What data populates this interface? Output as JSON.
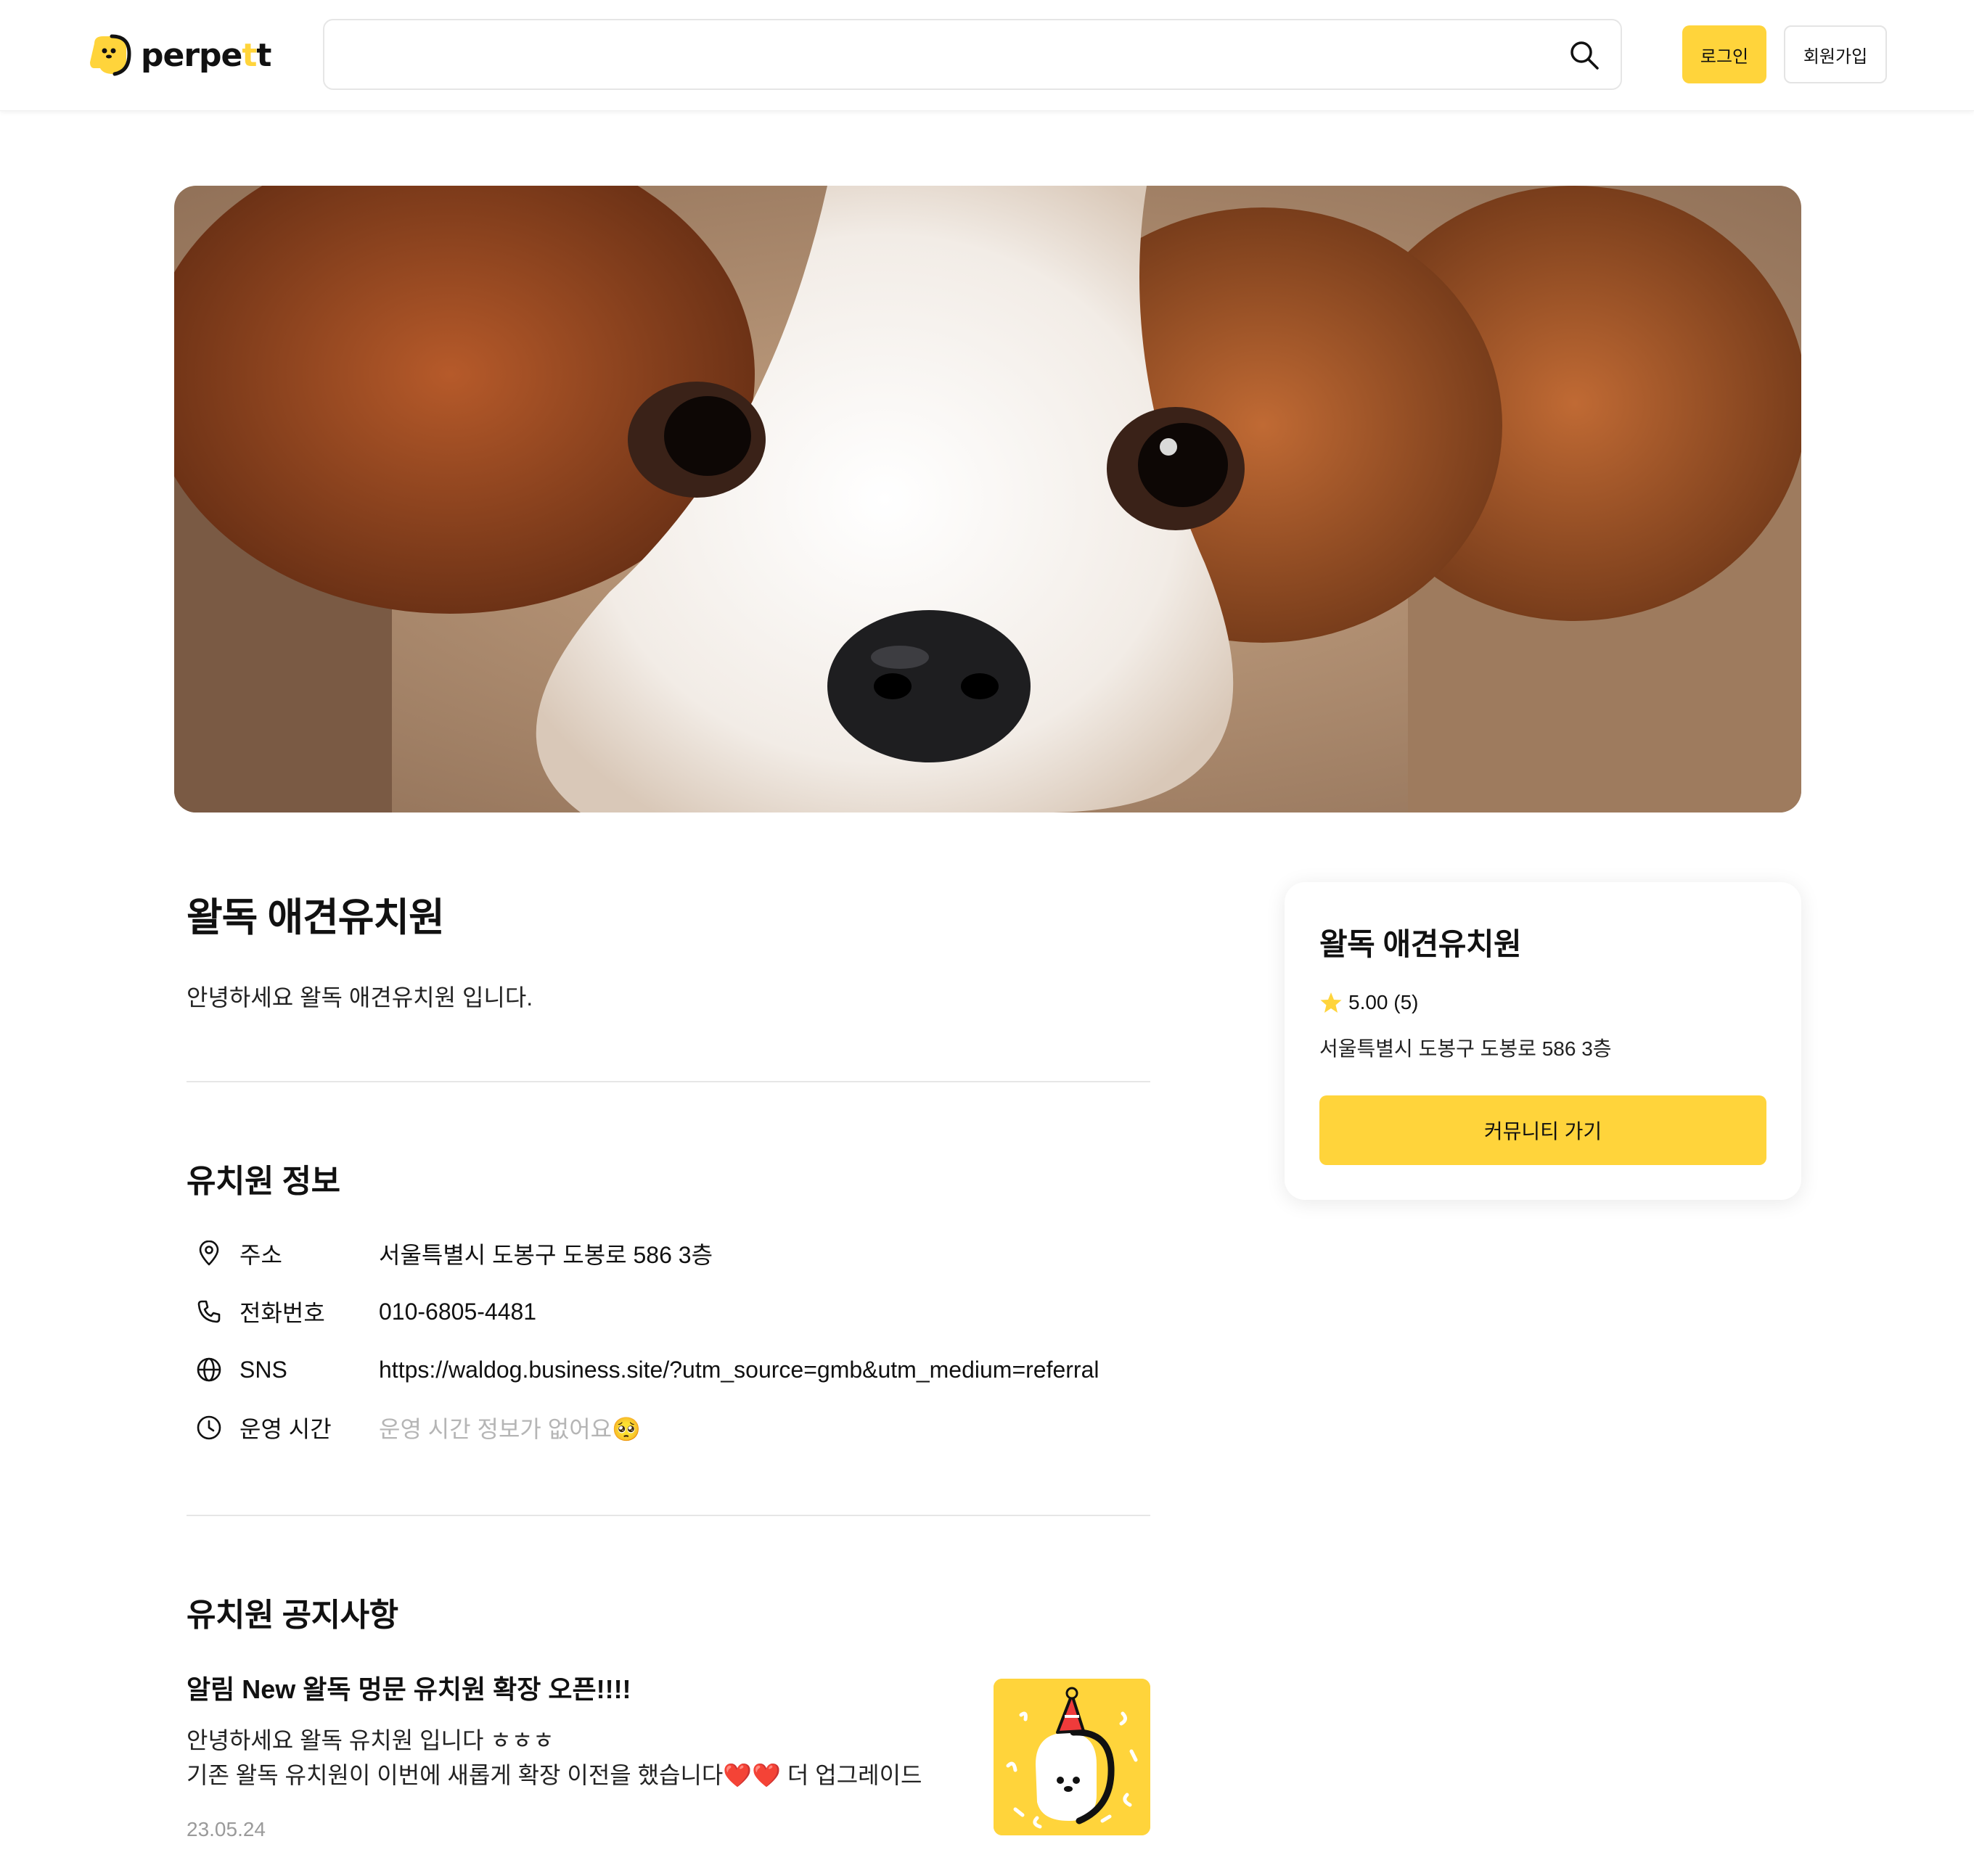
{
  "header": {
    "logo_text_start": "perpe",
    "logo_text_accent": "t",
    "logo_text_end": "t",
    "search_value": "",
    "search_placeholder": "",
    "login_label": "로그인",
    "signup_label": "회원가입"
  },
  "hero": {
    "image_subject": "puppy-photo"
  },
  "kindergarten": {
    "name": "왈독 애견유치원",
    "description": "안녕하세요 왈독 애견유치원 입니다."
  },
  "info_section": {
    "title": "유치원 정보",
    "rows": [
      {
        "icon": "location-pin-icon",
        "label": "주소",
        "value": "서울특별시 도봉구 도봉로 586 3층"
      },
      {
        "icon": "phone-icon",
        "label": "전화번호",
        "value": "010-6805-4481"
      },
      {
        "icon": "globe-icon",
        "label": "SNS",
        "value": "https://waldog.business.site/?utm_source=gmb&utm_medium=referral"
      },
      {
        "icon": "clock-icon",
        "label": "운영 시간",
        "value": "운영 시간 정보가 없어요🥺"
      }
    ]
  },
  "notice_section": {
    "title": "유치원 공지사항",
    "notices": [
      {
        "title": "알림 New 왈독 멍문 유치원 확장 오픈!!!!",
        "line1": "안녕하세요 왈독 유치원 입니다 ㅎㅎㅎ",
        "line2": "기존 왈독 유치원이 이번에 새롭게 확장 이전을 했습니다❤️❤️ 더 업그레이드",
        "date": "23.05.24"
      }
    ]
  },
  "side_card": {
    "name": "왈독 애견유치원",
    "rating": "5.00 (5)",
    "address": "서울특별시 도봉구 도봉로 586 3층",
    "button_label": "커뮤니티 가기"
  },
  "colors": {
    "accent": "#FFD43B",
    "muted_text": "#b5b5b5",
    "divider": "#e6e6e6"
  }
}
